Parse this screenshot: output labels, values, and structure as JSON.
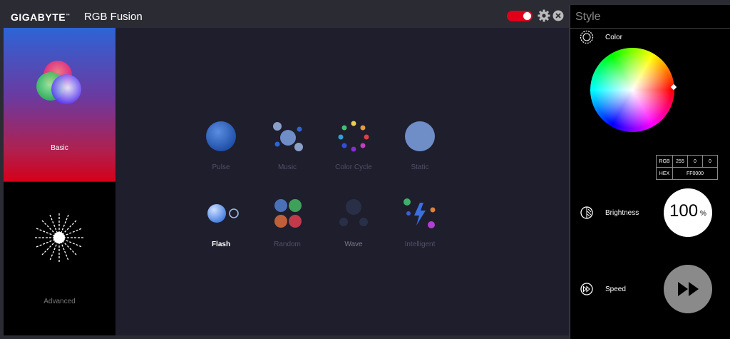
{
  "header": {
    "brand": "GIGABYTE",
    "brand_tm": "™",
    "title": "RGB Fusion",
    "power_on": true
  },
  "sidebar": {
    "items": [
      {
        "label": "Basic",
        "active": true
      },
      {
        "label": "Advanced",
        "active": false
      }
    ]
  },
  "effects": [
    {
      "label": "Pulse",
      "icon": "pulse-icon"
    },
    {
      "label": "Music",
      "icon": "music-icon"
    },
    {
      "label": "Color Cycle",
      "icon": "color-cycle-icon"
    },
    {
      "label": "Static",
      "icon": "static-icon"
    },
    {
      "label": "Flash",
      "icon": "flash-icon",
      "active": true
    },
    {
      "label": "Random",
      "icon": "random-icon"
    },
    {
      "label": "Wave",
      "icon": "wave-icon"
    },
    {
      "label": "Intelligent",
      "icon": "intelligent-icon"
    }
  ],
  "style_panel": {
    "title": "Style",
    "color": {
      "label": "Color",
      "rgb_label": "RGB",
      "r": "255",
      "g": "0",
      "b": "0",
      "hex_label": "HEX",
      "hex": "FF0000"
    },
    "brightness": {
      "label": "Brightness",
      "value": "100",
      "unit": "%"
    },
    "speed": {
      "label": "Speed"
    }
  },
  "colors": {
    "accent": "#e0001a",
    "main_bg": "#1e1e2d",
    "effect_blue": "#2d64d6"
  }
}
